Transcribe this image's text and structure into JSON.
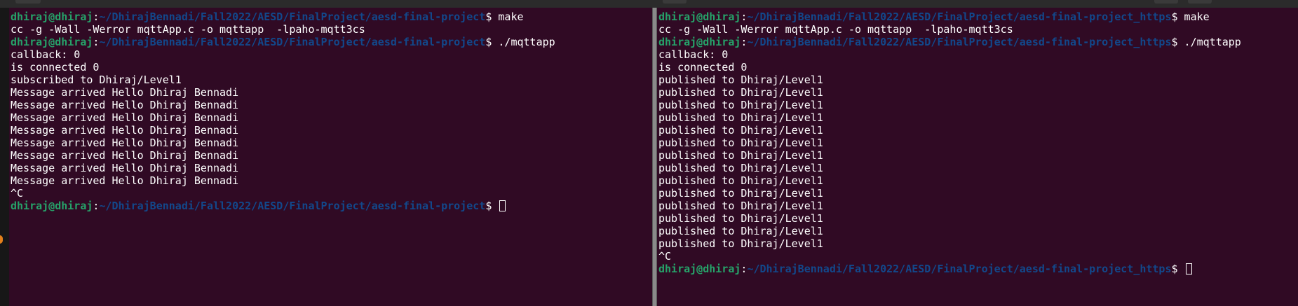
{
  "left_terminal": {
    "prompt_user": "dhiraj@dhiraj",
    "prompt_path": "~/DhirajBennadi/Fall2022/AESD/FinalProject/aesd-final-project",
    "prompt_sep": ":",
    "prompt_symbol": "$",
    "cmd1": " make",
    "out_compile": "cc -g -Wall -Werror mqttApp.c -o mqttapp  -lpaho-mqtt3cs",
    "cmd2": " ./mqttapp",
    "out_callback": "callback: 0",
    "out_connected": "is connected 0",
    "out_subscribed": "subscribed to Dhiraj/Level1",
    "messages": [
      "Message arrived Hello Dhiraj Bennadi",
      "Message arrived Hello Dhiraj Bennadi",
      "Message arrived Hello Dhiraj Bennadi",
      "Message arrived Hello Dhiraj Bennadi",
      "Message arrived Hello Dhiraj Bennadi",
      "Message arrived Hello Dhiraj Bennadi",
      "Message arrived Hello Dhiraj Bennadi",
      "Message arrived Hello Dhiraj Bennadi"
    ],
    "interrupt": "^C"
  },
  "right_terminal": {
    "prompt_user": "dhiraj@dhiraj",
    "prompt_path": "~/DhirajBennadi/Fall2022/AESD/FinalProject/aesd-final-project_https",
    "prompt_sep": ":",
    "prompt_symbol": "$",
    "cmd1": " make",
    "out_compile": "cc -g -Wall -Werror mqttApp.c -o mqttapp  -lpaho-mqtt3cs",
    "cmd2": " ./mqttapp",
    "out_callback": "callback: 0",
    "out_connected": "is connected 0",
    "published": [
      "published to Dhiraj/Level1",
      "published to Dhiraj/Level1",
      "published to Dhiraj/Level1",
      "published to Dhiraj/Level1",
      "published to Dhiraj/Level1",
      "published to Dhiraj/Level1",
      "published to Dhiraj/Level1",
      "published to Dhiraj/Level1",
      "published to Dhiraj/Level1",
      "published to Dhiraj/Level1",
      "published to Dhiraj/Level1",
      "published to Dhiraj/Level1",
      "published to Dhiraj/Level1",
      "published to Dhiraj/Level1"
    ],
    "interrupt": "^C"
  },
  "colors": {
    "background": "#300a24",
    "user": "#26a269",
    "path": "#12488b",
    "text": "#ffffff"
  }
}
